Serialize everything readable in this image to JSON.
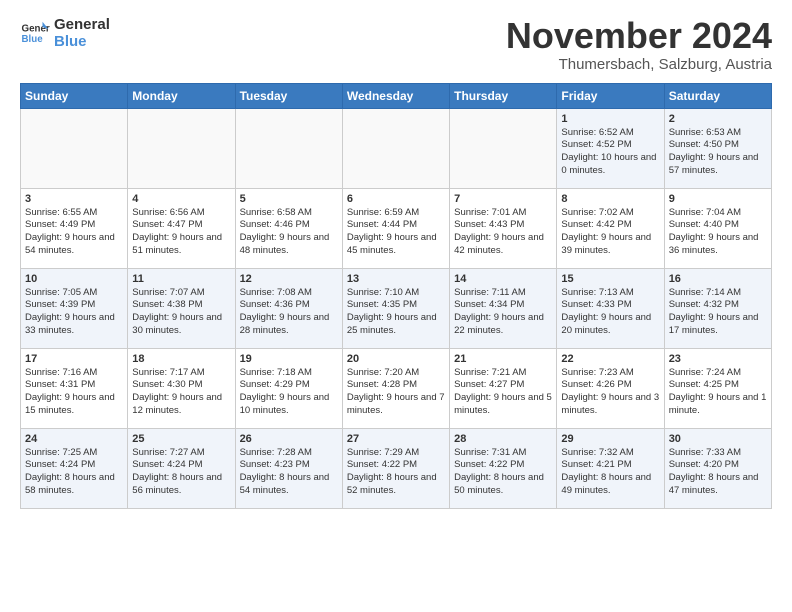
{
  "logo": {
    "line1": "General",
    "line2": "Blue"
  },
  "title": "November 2024",
  "subtitle": "Thumersbach, Salzburg, Austria",
  "days_of_week": [
    "Sunday",
    "Monday",
    "Tuesday",
    "Wednesday",
    "Thursday",
    "Friday",
    "Saturday"
  ],
  "weeks": [
    [
      {
        "day": "",
        "info": ""
      },
      {
        "day": "",
        "info": ""
      },
      {
        "day": "",
        "info": ""
      },
      {
        "day": "",
        "info": ""
      },
      {
        "day": "",
        "info": ""
      },
      {
        "day": "1",
        "info": "Sunrise: 6:52 AM\nSunset: 4:52 PM\nDaylight: 10 hours and 0 minutes."
      },
      {
        "day": "2",
        "info": "Sunrise: 6:53 AM\nSunset: 4:50 PM\nDaylight: 9 hours and 57 minutes."
      }
    ],
    [
      {
        "day": "3",
        "info": "Sunrise: 6:55 AM\nSunset: 4:49 PM\nDaylight: 9 hours and 54 minutes."
      },
      {
        "day": "4",
        "info": "Sunrise: 6:56 AM\nSunset: 4:47 PM\nDaylight: 9 hours and 51 minutes."
      },
      {
        "day": "5",
        "info": "Sunrise: 6:58 AM\nSunset: 4:46 PM\nDaylight: 9 hours and 48 minutes."
      },
      {
        "day": "6",
        "info": "Sunrise: 6:59 AM\nSunset: 4:44 PM\nDaylight: 9 hours and 45 minutes."
      },
      {
        "day": "7",
        "info": "Sunrise: 7:01 AM\nSunset: 4:43 PM\nDaylight: 9 hours and 42 minutes."
      },
      {
        "day": "8",
        "info": "Sunrise: 7:02 AM\nSunset: 4:42 PM\nDaylight: 9 hours and 39 minutes."
      },
      {
        "day": "9",
        "info": "Sunrise: 7:04 AM\nSunset: 4:40 PM\nDaylight: 9 hours and 36 minutes."
      }
    ],
    [
      {
        "day": "10",
        "info": "Sunrise: 7:05 AM\nSunset: 4:39 PM\nDaylight: 9 hours and 33 minutes."
      },
      {
        "day": "11",
        "info": "Sunrise: 7:07 AM\nSunset: 4:38 PM\nDaylight: 9 hours and 30 minutes."
      },
      {
        "day": "12",
        "info": "Sunrise: 7:08 AM\nSunset: 4:36 PM\nDaylight: 9 hours and 28 minutes."
      },
      {
        "day": "13",
        "info": "Sunrise: 7:10 AM\nSunset: 4:35 PM\nDaylight: 9 hours and 25 minutes."
      },
      {
        "day": "14",
        "info": "Sunrise: 7:11 AM\nSunset: 4:34 PM\nDaylight: 9 hours and 22 minutes."
      },
      {
        "day": "15",
        "info": "Sunrise: 7:13 AM\nSunset: 4:33 PM\nDaylight: 9 hours and 20 minutes."
      },
      {
        "day": "16",
        "info": "Sunrise: 7:14 AM\nSunset: 4:32 PM\nDaylight: 9 hours and 17 minutes."
      }
    ],
    [
      {
        "day": "17",
        "info": "Sunrise: 7:16 AM\nSunset: 4:31 PM\nDaylight: 9 hours and 15 minutes."
      },
      {
        "day": "18",
        "info": "Sunrise: 7:17 AM\nSunset: 4:30 PM\nDaylight: 9 hours and 12 minutes."
      },
      {
        "day": "19",
        "info": "Sunrise: 7:18 AM\nSunset: 4:29 PM\nDaylight: 9 hours and 10 minutes."
      },
      {
        "day": "20",
        "info": "Sunrise: 7:20 AM\nSunset: 4:28 PM\nDaylight: 9 hours and 7 minutes."
      },
      {
        "day": "21",
        "info": "Sunrise: 7:21 AM\nSunset: 4:27 PM\nDaylight: 9 hours and 5 minutes."
      },
      {
        "day": "22",
        "info": "Sunrise: 7:23 AM\nSunset: 4:26 PM\nDaylight: 9 hours and 3 minutes."
      },
      {
        "day": "23",
        "info": "Sunrise: 7:24 AM\nSunset: 4:25 PM\nDaylight: 9 hours and 1 minute."
      }
    ],
    [
      {
        "day": "24",
        "info": "Sunrise: 7:25 AM\nSunset: 4:24 PM\nDaylight: 8 hours and 58 minutes."
      },
      {
        "day": "25",
        "info": "Sunrise: 7:27 AM\nSunset: 4:24 PM\nDaylight: 8 hours and 56 minutes."
      },
      {
        "day": "26",
        "info": "Sunrise: 7:28 AM\nSunset: 4:23 PM\nDaylight: 8 hours and 54 minutes."
      },
      {
        "day": "27",
        "info": "Sunrise: 7:29 AM\nSunset: 4:22 PM\nDaylight: 8 hours and 52 minutes."
      },
      {
        "day": "28",
        "info": "Sunrise: 7:31 AM\nSunset: 4:22 PM\nDaylight: 8 hours and 50 minutes."
      },
      {
        "day": "29",
        "info": "Sunrise: 7:32 AM\nSunset: 4:21 PM\nDaylight: 8 hours and 49 minutes."
      },
      {
        "day": "30",
        "info": "Sunrise: 7:33 AM\nSunset: 4:20 PM\nDaylight: 8 hours and 47 minutes."
      }
    ]
  ]
}
